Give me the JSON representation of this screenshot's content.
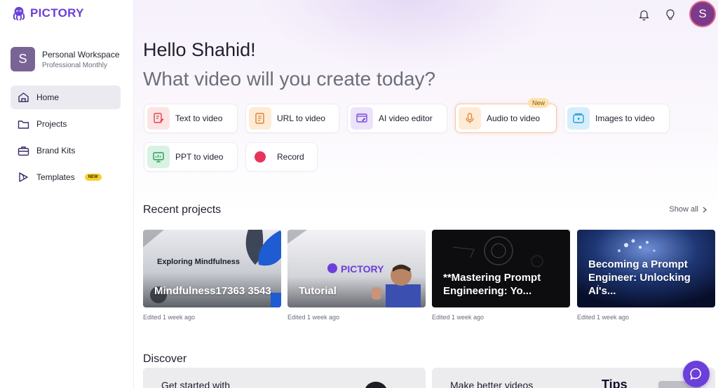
{
  "app": {
    "name": "PICTORY",
    "brand_color": "#6b3fd9"
  },
  "workspace": {
    "avatar_letter": "S",
    "name": "Personal Workspace",
    "plan": "Professional Monthly"
  },
  "sidebar": {
    "items": [
      {
        "label": "Home",
        "icon": "home-icon",
        "active": true
      },
      {
        "label": "Projects",
        "icon": "folder-icon"
      },
      {
        "label": "Brand Kits",
        "icon": "briefcase-icon"
      },
      {
        "label": "Templates",
        "icon": "templates-icon",
        "badge": "NEW"
      }
    ]
  },
  "topbar": {
    "user_initial": "S"
  },
  "hero": {
    "greeting": "Hello Shahid!",
    "question": "What video will you create today?"
  },
  "create_options": [
    {
      "label": "Text to video",
      "icon": "text-to-video-icon"
    },
    {
      "label": "URL to video",
      "icon": "url-icon"
    },
    {
      "label": "AI video editor",
      "icon": "ai-editor-icon"
    },
    {
      "label": "Audio to video",
      "icon": "microphone-icon",
      "tag": "New"
    },
    {
      "label": "Images to video",
      "icon": "images-icon"
    },
    {
      "label": "PPT to video",
      "icon": "ppt-icon"
    },
    {
      "label": "Record",
      "icon": "record-icon"
    }
  ],
  "recent": {
    "title": "Recent projects",
    "show_all": "Show all",
    "projects": [
      {
        "title": "Mindfulness17363 3543",
        "overlay": "Exploring Mindfulness",
        "edited": "Edited 1 week ago"
      },
      {
        "title": "Tutorial",
        "overlay": "PICTORY",
        "edited": "Edited 1 week ago"
      },
      {
        "title": "**Mastering Prompt Engineering: Yo...",
        "edited": "Edited 1 week ago"
      },
      {
        "title": "Becoming a Prompt Engineer: Unlocking AI's...",
        "edited": "Edited 1 week ago"
      }
    ]
  },
  "discover": {
    "title": "Discover",
    "cards": [
      {
        "text": "Get started with"
      },
      {
        "text": "Make better videos",
        "side": "Tips"
      }
    ]
  }
}
